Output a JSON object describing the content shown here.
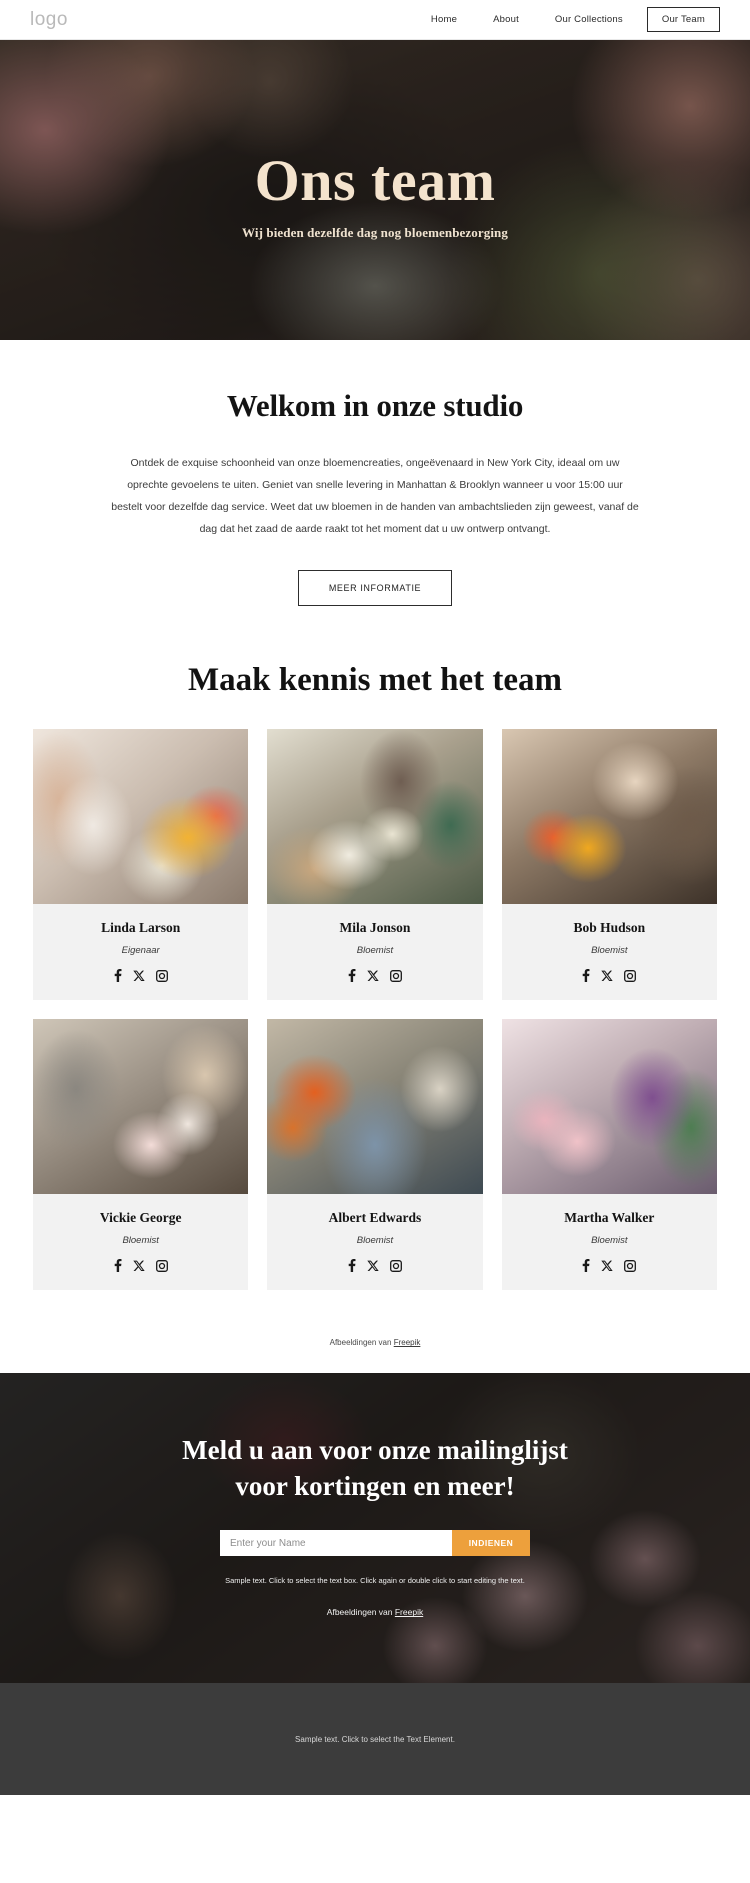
{
  "header": {
    "logo": "logo",
    "nav": [
      {
        "label": "Home",
        "active": false
      },
      {
        "label": "About",
        "active": false
      },
      {
        "label": "Our Collections",
        "active": false
      },
      {
        "label": "Our Team",
        "active": true
      }
    ]
  },
  "hero": {
    "title": "Ons team",
    "subtitle": "Wij bieden dezelfde dag nog bloemenbezorging"
  },
  "welcome": {
    "title": "Welkom in onze studio",
    "paragraph": "Ontdek de exquise schoonheid van onze bloemencreaties, ongeëvenaard in New York City, ideaal om uw oprechte gevoelens te uiten. Geniet van snelle levering in Manhattan & Brooklyn wanneer u voor 15:00 uur bestelt voor dezelfde dag service. Weet dat uw bloemen in de handen van ambachtslieden zijn geweest, vanaf de dag dat het zaad de aarde raakt tot het moment dat u uw ontwerp ontvangt.",
    "button": "MEER INFORMATIE"
  },
  "team": {
    "title": "Maak kennis met het team",
    "social_icons": [
      "facebook-icon",
      "x-twitter-icon",
      "instagram-icon"
    ],
    "members": [
      {
        "name": "Linda Larson",
        "role": "Eigenaar"
      },
      {
        "name": "Mila Jonson",
        "role": "Bloemist"
      },
      {
        "name": "Bob Hudson",
        "role": "Bloemist"
      },
      {
        "name": "Vickie George",
        "role": "Bloemist"
      },
      {
        "name": "Albert Edwards",
        "role": "Bloemist"
      },
      {
        "name": "Martha Walker",
        "role": "Bloemist"
      }
    ],
    "credit_prefix": "Afbeeldingen van ",
    "credit_link": "Freepik"
  },
  "newsletter": {
    "title_line1": "Meld u aan voor onze mailinglijst",
    "title_line2": "voor kortingen en meer!",
    "input_placeholder": "Enter your Name",
    "input_value": "",
    "submit_label": "INDIENEN",
    "note": "Sample text. Click to select the text box. Click again or double click to start editing the text.",
    "credit_prefix": "Afbeeldingen van ",
    "credit_link": "Freepik"
  },
  "footer": {
    "text": "Sample text. Click to select the Text Element."
  },
  "colors": {
    "accent": "#eda03c",
    "hero_text": "#f4e3cd",
    "card_bg": "#f2f2f2",
    "footer_bg": "#3c3c3c"
  }
}
